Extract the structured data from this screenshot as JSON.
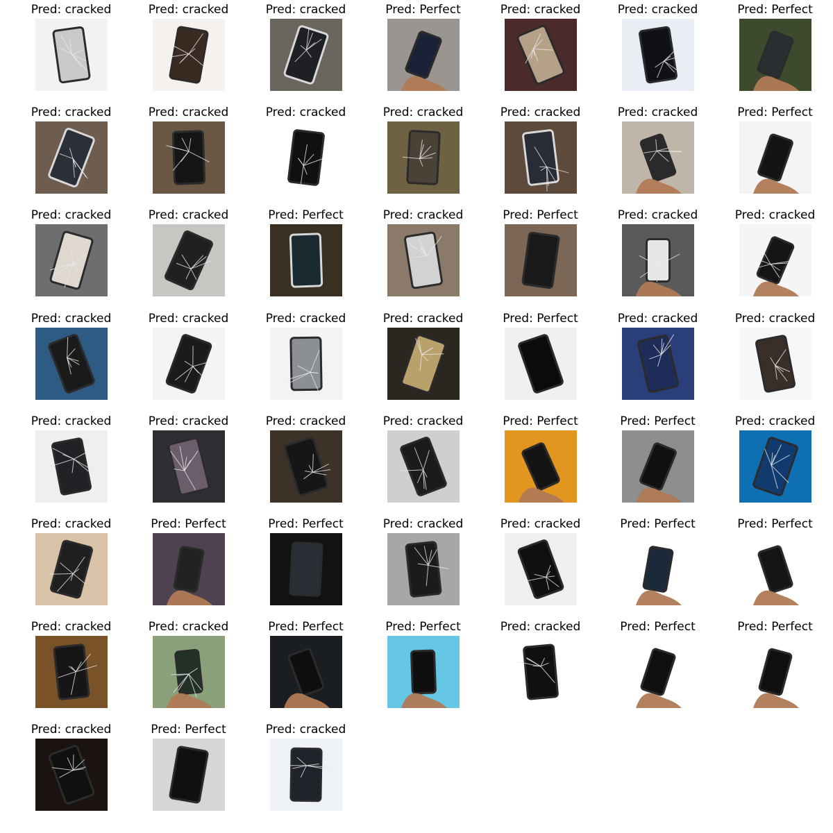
{
  "prefix": "Pred: ",
  "items": [
    {
      "label": "cracked",
      "bg": "#f2f2f2",
      "fg": "#c9c9c9",
      "style": "phone-light"
    },
    {
      "label": "cracked",
      "bg": "#f4f1ee",
      "fg": "#3a2a22",
      "style": "phone-dark"
    },
    {
      "label": "cracked",
      "bg": "#6a655d",
      "fg": "#1e2024",
      "style": "phone-white-frame"
    },
    {
      "label": "Perfect",
      "bg": "#9a9590",
      "fg": "#1a2238",
      "style": "hand-phone"
    },
    {
      "label": "cracked",
      "bg": "#4a2a2a",
      "fg": "#b5a088",
      "style": "phone-light"
    },
    {
      "label": "cracked",
      "bg": "#e9eef4",
      "fg": "#0f1115",
      "style": "phone-dark"
    },
    {
      "label": "Perfect",
      "bg": "#3e4a2e",
      "fg": "#2a2e30",
      "style": "hand-phone"
    },
    {
      "label": "cracked",
      "bg": "#6e5c4e",
      "fg": "#2a2f38",
      "style": "phone-white-frame"
    },
    {
      "label": "cracked",
      "bg": "#6a5844",
      "fg": "#151515",
      "style": "phone-dark"
    },
    {
      "label": "cracked",
      "bg": "#ffffff",
      "fg": "#101010",
      "style": "phone-dark"
    },
    {
      "label": "cracked",
      "bg": "#6f6242",
      "fg": "#4b4237",
      "style": "phone-light"
    },
    {
      "label": "cracked",
      "bg": "#5d4a3b",
      "fg": "#2a2c35",
      "style": "phone-white-frame"
    },
    {
      "label": "cracked",
      "bg": "#bfb5a9",
      "fg": "#2a2a2a",
      "style": "hand-phone"
    },
    {
      "label": "Perfect",
      "bg": "#f4f4f4",
      "fg": "#141414",
      "style": "hand-phone"
    },
    {
      "label": "cracked",
      "bg": "#6e6e6e",
      "fg": "#ded8cf",
      "style": "phone-light"
    },
    {
      "label": "cracked",
      "bg": "#c8c6c2",
      "fg": "#202020",
      "style": "phone-dark"
    },
    {
      "label": "Perfect",
      "bg": "#3a3022",
      "fg": "#1a2a30",
      "style": "phone-white-frame"
    },
    {
      "label": "cracked",
      "bg": "#8b7a6a",
      "fg": "#d2d2d2",
      "style": "phone-light"
    },
    {
      "label": "Perfect",
      "bg": "#7c6655",
      "fg": "#1a1a1a",
      "style": "phone-dark"
    },
    {
      "label": "cracked",
      "bg": "#5a5a5a",
      "fg": "#e6e6e6",
      "style": "hand-phone"
    },
    {
      "label": "cracked",
      "bg": "#f5f5f5",
      "fg": "#151515",
      "style": "hand-phone"
    },
    {
      "label": "cracked",
      "bg": "#2e5b84",
      "fg": "#1a1a1a",
      "style": "phone-dark"
    },
    {
      "label": "cracked",
      "bg": "#f4f4f4",
      "fg": "#1b1b1b",
      "style": "phone-dark"
    },
    {
      "label": "cracked",
      "bg": "#f3f3f3",
      "fg": "#8c8f94",
      "style": "phone-light"
    },
    {
      "label": "cracked",
      "bg": "#2a2620",
      "fg": "#b9a16c",
      "style": "phone-light"
    },
    {
      "label": "Perfect",
      "bg": "#f0f0f0",
      "fg": "#0b0b0b",
      "style": "phone-dark"
    },
    {
      "label": "cracked",
      "bg": "#2a3e7a",
      "fg": "#1d2c59",
      "style": "phone-dark"
    },
    {
      "label": "cracked",
      "bg": "#f7f7f7",
      "fg": "#3a2f28",
      "style": "phone-light"
    },
    {
      "label": "cracked",
      "bg": "#efefef",
      "fg": "#202226",
      "style": "phone-light"
    },
    {
      "label": "cracked",
      "bg": "#2f2f33",
      "fg": "#6b5d6a",
      "style": "phone-dark"
    },
    {
      "label": "cracked",
      "bg": "#3d3227",
      "fg": "#161616",
      "style": "phone-dark"
    },
    {
      "label": "cracked",
      "bg": "#cfcfcf",
      "fg": "#1b1b1b",
      "style": "phone-dark"
    },
    {
      "label": "Perfect",
      "bg": "#e2961f",
      "fg": "#141414",
      "style": "hand-phone"
    },
    {
      "label": "Perfect",
      "bg": "#8e8e8e",
      "fg": "#111111",
      "style": "hand-phone"
    },
    {
      "label": "cracked",
      "bg": "#0f6fb3",
      "fg": "#113b6e",
      "style": "phone-dark"
    },
    {
      "label": "cracked",
      "bg": "#d8c3a8",
      "fg": "#1f1f1f",
      "style": "phone-dark"
    },
    {
      "label": "Perfect",
      "bg": "#4e4250",
      "fg": "#222222",
      "style": "hand-phone"
    },
    {
      "label": "Perfect",
      "bg": "#121212",
      "fg": "#2a2f35",
      "style": "phone-dark"
    },
    {
      "label": "cracked",
      "bg": "#a7a7a7",
      "fg": "#1b1b1b",
      "style": "phone-dark"
    },
    {
      "label": "cracked",
      "bg": "#efefef",
      "fg": "#101010",
      "style": "phone-dark"
    },
    {
      "label": "Perfect",
      "bg": "#ffffff",
      "fg": "#1b2a3a",
      "style": "hand-phone"
    },
    {
      "label": "Perfect",
      "bg": "#ffffff",
      "fg": "#151515",
      "style": "hand-phone"
    },
    {
      "label": "cracked",
      "bg": "#7a5228",
      "fg": "#161616",
      "style": "phone-dark"
    },
    {
      "label": "cracked",
      "bg": "#8aa07b",
      "fg": "#223028",
      "style": "hand-phone"
    },
    {
      "label": "Perfect",
      "bg": "#1a1d22",
      "fg": "#0f0f0f",
      "style": "hand-phone"
    },
    {
      "label": "Perfect",
      "bg": "#66c6e6",
      "fg": "#0f0f0f",
      "style": "hand-phone"
    },
    {
      "label": "cracked",
      "bg": "#ffffff",
      "fg": "#101010",
      "style": "phone-light"
    },
    {
      "label": "Perfect",
      "bg": "#ffffff",
      "fg": "#101010",
      "style": "hand-phone"
    },
    {
      "label": "Perfect",
      "bg": "#ffffff",
      "fg": "#101010",
      "style": "hand-phone"
    },
    {
      "label": "cracked",
      "bg": "#1b130f",
      "fg": "#101010",
      "style": "phone-dark"
    },
    {
      "label": "Perfect",
      "bg": "#d6d6d6",
      "fg": "#101010",
      "style": "phone-dark"
    },
    {
      "label": "cracked",
      "bg": "#eef1f5",
      "fg": "#20242a",
      "style": "phone-dark"
    }
  ]
}
